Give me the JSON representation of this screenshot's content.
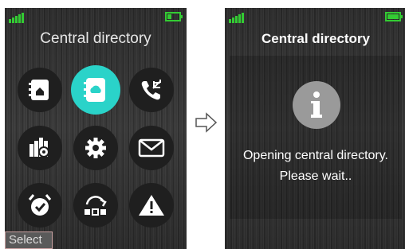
{
  "left_screen": {
    "title": "Central directory",
    "softkey_select": "Select",
    "menu_icons": [
      "phonebook-icon",
      "central-directory-icon",
      "call-list-icon",
      "profiles-icon",
      "settings-icon",
      "messages-icon",
      "alarm-icon",
      "shortcut-icon",
      "alert-icon"
    ]
  },
  "right_screen": {
    "title": "Central directory",
    "message_line1": "Opening central directory.",
    "message_line2": "Please wait..",
    "icon": "info-icon"
  },
  "colors": {
    "signal": "#33cc33",
    "accent": "#2ad3c9"
  }
}
